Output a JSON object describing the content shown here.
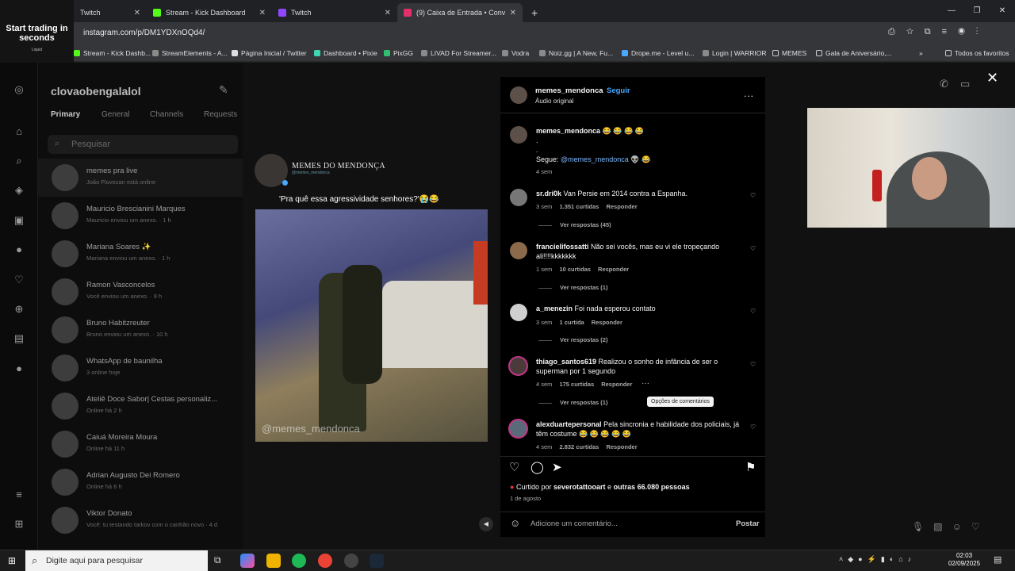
{
  "browser": {
    "tabs": [
      {
        "label": "Twitch",
        "color": "#9146ff"
      },
      {
        "label": "Stream - Kick Dashboard",
        "color": "#53fc18"
      },
      {
        "label": "Twitch",
        "color": "#9146ff"
      },
      {
        "label": "(9) Caixa de Entrada • Conv",
        "color": "#e1306c",
        "active": true
      }
    ],
    "new_tab": "+",
    "url": "instagram.com/p/DM1YDXnOQd4/",
    "bookmarks": [
      "Stream - Kick Dashb...",
      "StreamElements - A...",
      "Página Inicial / Twitter",
      "Dashboard • Pixie",
      "PixGG",
      "LIVAD For Streamer...",
      "Vodra",
      "Noiz.gg | A New, Fu...",
      "Drope.me - Level u...",
      "Login | WARRIOR",
      "MEMES",
      "Gala de Aniversário,..."
    ],
    "all_bookmarks": "Todos os favoritos",
    "more": "»"
  },
  "promo": {
    "title": "Start trading in seconds",
    "brand": "Liquid"
  },
  "dm": {
    "username": "clovaobengalalol",
    "tabs": [
      "Primary",
      "General",
      "Channels",
      "Requests"
    ],
    "search_placeholder": "Pesquisar",
    "conversations": [
      {
        "name": "memes pra live",
        "sub": "João Flovezan está online"
      },
      {
        "name": "Mauricio Brescianini Marques",
        "sub": "Mauricio enviou um anexo. · 1 h"
      },
      {
        "name": "Mariana Soares ✨",
        "sub": "Mariana enviou um anexo. · 1 h"
      },
      {
        "name": "Ramon Vasconcelos",
        "sub": "Você enviou um anexo. · 9 h"
      },
      {
        "name": "Bruno Habitzreuter",
        "sub": "Bruno enviou um anexo. · 10 h"
      },
      {
        "name": "WhatsApp de baunilha",
        "sub": "3 online hoje"
      },
      {
        "name": "Ateliê Doce Sabor| Cestas personaliz...",
        "sub": "Online há 2 h"
      },
      {
        "name": "Caiuá Moreira Moura",
        "sub": "Online há 11 h"
      },
      {
        "name": "Adrian Augusto Dei Romero",
        "sub": "Online há 6 h"
      },
      {
        "name": "Viktor Donato",
        "sub": "Você: tu testando tarkov com o canhão novo · 4 d"
      }
    ]
  },
  "post": {
    "brand": "MEMES DO MENDONÇA",
    "brand_handle": "@memes_mendonca",
    "caption": "'Pra quê essa agressividade senhores?'😭😂",
    "watermark": "@memes_mendonca"
  },
  "comments": {
    "header": {
      "user": "memes_mendonca",
      "dot": "•",
      "follow": "Seguir",
      "sub": "Áudio original",
      "more": "..."
    },
    "author": {
      "user": "memes_mendonca",
      "text": "😂 😂 😂 😂",
      "line2": ".",
      "line3": ".",
      "follow_label": "Segue:",
      "mention": "@memes_mendonca",
      "emoji": "👽 😂",
      "time": "4 sem"
    },
    "items": [
      {
        "user": "sr.dri0k",
        "text": "Van Persie em 2014 contra a Espanha.",
        "time": "3 sem",
        "likes": "1.351 curtidas",
        "reply": "Responder",
        "replies": "Ver respostas (45)"
      },
      {
        "user": "francielifossatti",
        "text": "Não sei vocês, mas eu vi ele tropeçando ali!!!!kkkkkkk",
        "time": "1 sem",
        "likes": "10 curtidas",
        "reply": "Responder",
        "replies": "Ver respostas (1)"
      },
      {
        "user": "a_menezin",
        "text": "Foi nada esperou contato",
        "time": "3 sem",
        "likes": "1 curtida",
        "reply": "Responder",
        "replies": "Ver respostas (2)"
      },
      {
        "user": "thiago_santos619",
        "text": "Realizou o sonho de infância de ser o superman por 1 segundo",
        "time": "4 sem",
        "likes": "175 curtidas",
        "reply": "Responder",
        "replies": "Ver respostas (1)"
      },
      {
        "user": "alexduartepersonal",
        "text": "Pela sincronia e habilidade dos policiais, já têm costume 😂 😂 😂 😂 😂",
        "time": "4 sem",
        "likes": "2.832 curtidas",
        "reply": "Responder"
      }
    ],
    "tooltip": "Opções de comentários",
    "likes_prefix": "Curtido por",
    "likes_user": "severotattooart",
    "likes_and": "e",
    "likes_others": "outras 66.080 pessoas",
    "date": "1 de agosto",
    "add_placeholder": "Adicione um comentário...",
    "post_button": "Postar"
  },
  "taskbar": {
    "search_placeholder": "Digite aqui para pesquisar",
    "time": "02:03",
    "date": "02/09/2025"
  },
  "icons": [
    "instagram-icon",
    "home-icon",
    "search-icon",
    "explore-icon",
    "reels-icon",
    "messages-icon",
    "heart-icon",
    "create-icon",
    "dashboard-icon",
    "profile-icon",
    "menu-icon",
    "threads-icon"
  ]
}
